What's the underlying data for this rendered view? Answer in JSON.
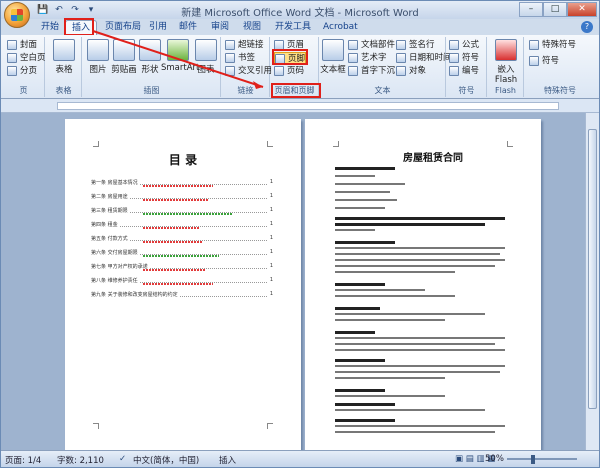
{
  "window": {
    "title": "新建 Microsoft Office Word 文档 - Microsoft Word"
  },
  "qat": {
    "save": "💾",
    "undo": "↶",
    "redo": "↷",
    "more": "▾"
  },
  "controls": {
    "minimize": "–",
    "maximize": "□",
    "close": "✕"
  },
  "tabs": [
    "开始",
    "插入",
    "页面布局",
    "引用",
    "邮件",
    "审阅",
    "视图",
    "开发工具",
    "Acrobat"
  ],
  "active_tab": "插入",
  "help": "?",
  "ribbon": {
    "pages": {
      "items": [
        "封面",
        "空白页",
        "分页"
      ],
      "label": "页"
    },
    "tables": {
      "button": "表格",
      "label": "表格"
    },
    "illustrations": {
      "buttons": [
        "图片",
        "剪贴画",
        "形状",
        "SmartArt",
        "图表"
      ],
      "label": "插图"
    },
    "links": {
      "items": [
        "超链接",
        "书签",
        "交叉引用"
      ],
      "label": "链接"
    },
    "header_footer": {
      "items": [
        "页眉",
        "页脚",
        "页码"
      ],
      "label": "页眉和页脚"
    },
    "text": {
      "textbox": "文本框",
      "items_a": [
        "文档部件",
        "艺术字",
        "首字下沉"
      ],
      "items_b": [
        "签名行",
        "日期和时间",
        "对象"
      ],
      "label": "文本"
    },
    "symbols": {
      "items": [
        "公式",
        "符号",
        "编号"
      ],
      "label": "符号"
    },
    "flash": {
      "button": "嵌入 Flash",
      "label": "Flash"
    },
    "special": {
      "items": [
        "特殊符号",
        "符号"
      ],
      "label": "特殊符号"
    }
  },
  "page1": {
    "title": "目  录",
    "toc": [
      {
        "label": "第一条 房屋基本情况",
        "page": "1"
      },
      {
        "label": "第二条 房屋用途",
        "page": "1"
      },
      {
        "label": "第三条 租赁期限",
        "page": "1"
      },
      {
        "label": "第四条 租金",
        "page": "1"
      },
      {
        "label": "第五条 付款方式",
        "page": "1"
      },
      {
        "label": "第六条 交付房屋期限",
        "page": "1"
      },
      {
        "label": "第七条 甲方对产权的承诺",
        "page": "1"
      },
      {
        "label": "第八条 维修养护责任",
        "page": "1"
      },
      {
        "label": "第九条 关于装修和改变房屋结构的约定",
        "page": "1"
      }
    ]
  },
  "page2": {
    "title": "房屋租赁合同"
  },
  "status": {
    "page": "页面: 1/4",
    "words": "字数: 2,110",
    "lang": "中文(简体，中国)",
    "mode": "插入",
    "zoom": "50%"
  }
}
